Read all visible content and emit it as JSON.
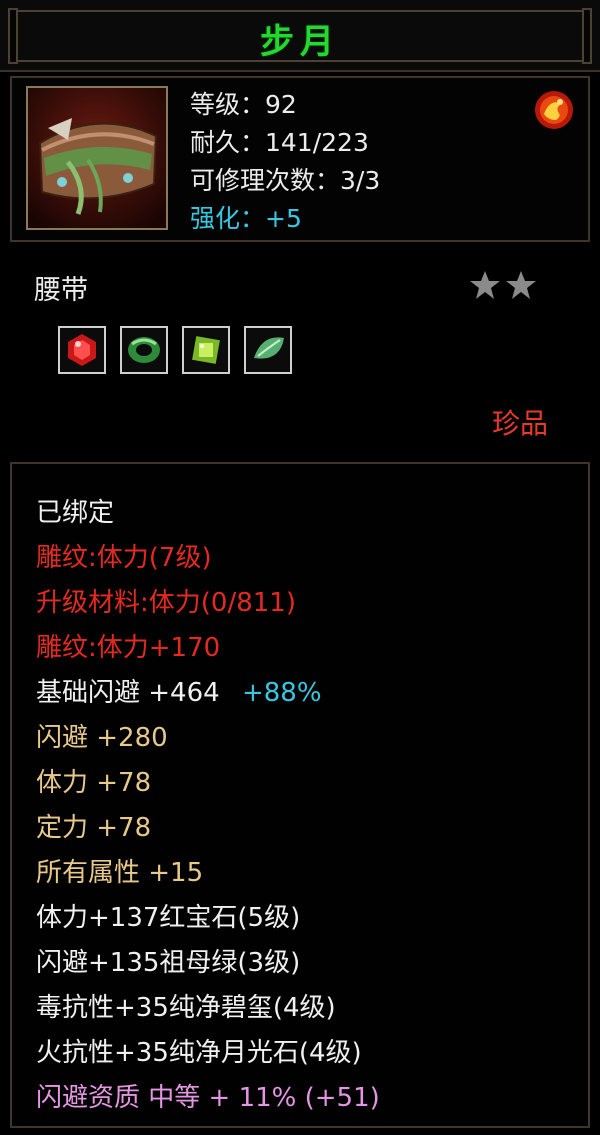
{
  "title": "步月",
  "header": {
    "level": "等级：92",
    "durability": "耐久：141/223",
    "repairs": "可修理次数：3/3",
    "enhance": "强化：+5"
  },
  "item_type": "腰带",
  "star_count": 2,
  "rarity": "珍品",
  "colors": {
    "title": "#23d82e",
    "red": "#e22a22",
    "gold": "#e8c98a",
    "cyan": "#38c7e0",
    "pink": "#e496e2",
    "white": "#f0f0f0"
  },
  "gems": [
    "red-ruby-gem-icon",
    "green-jade-ring-icon",
    "green-peridot-gem-icon",
    "green-leaf-jade-icon"
  ],
  "details": {
    "bound": "已绑定",
    "engrave1": "雕纹:体力(7级)",
    "upgrade_material": "升级材料:体力(0/811)",
    "engrave2": "雕纹:体力+170",
    "base_dodge_label": "基础闪避  +464",
    "base_dodge_pct": "+88%",
    "dodge": "闪避  +280",
    "stamina": "体力  +78",
    "focus": "定力  +78",
    "all_attr": "所有属性  +15",
    "gem1": "体力+137红宝石(5级)",
    "gem2": "闪避+135祖母绿(3级)",
    "gem3": "毒抗性+35纯净碧玺(4级)",
    "gem4": "火抗性+35纯净月光石(4级)",
    "aptitude": "闪避资质  中等  + 11% (+51)"
  }
}
